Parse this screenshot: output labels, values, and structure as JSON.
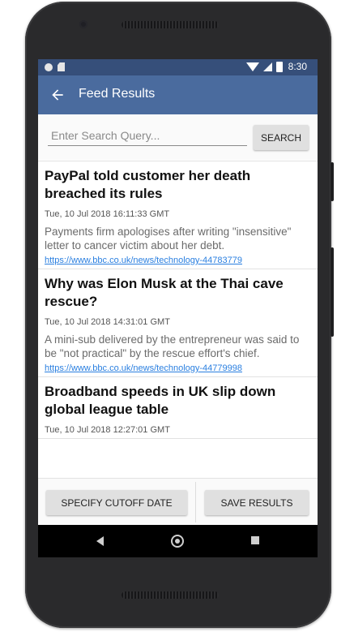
{
  "status_bar": {
    "time": "8:30"
  },
  "app_bar": {
    "title": "Feed Results",
    "back_icon": "arrow-left-icon"
  },
  "search": {
    "placeholder": "Enter Search Query...",
    "value": "",
    "button_label": "SEARCH"
  },
  "feed": {
    "items": [
      {
        "title": "PayPal told customer her death breached its rules",
        "date": "Tue, 10 Jul 2018 16:11:33 GMT",
        "description": "Payments firm apologises after writing \"insensitive\" letter to cancer victim about her debt.",
        "link": "https://www.bbc.co.uk/news/technology-44783779"
      },
      {
        "title": "Why was Elon Musk at the Thai cave rescue?",
        "date": "Tue, 10 Jul 2018 14:31:01 GMT",
        "description": "A mini-sub delivered by the entrepreneur was said to be \"not practical\" by the rescue effort's chief.",
        "link": "https://www.bbc.co.uk/news/technology-44779998"
      },
      {
        "title": "Broadband speeds in UK slip down global league table",
        "date": "Tue, 10 Jul 2018 12:27:01 GMT",
        "description": "",
        "link": ""
      }
    ]
  },
  "actions": {
    "cutoff_label": "SPECIFY CUTOFF DATE",
    "save_label": "SAVE RESULTS"
  },
  "colors": {
    "status_bar": "#364f7a",
    "app_bar": "#4a6b9e",
    "link": "#2a7fe0"
  }
}
